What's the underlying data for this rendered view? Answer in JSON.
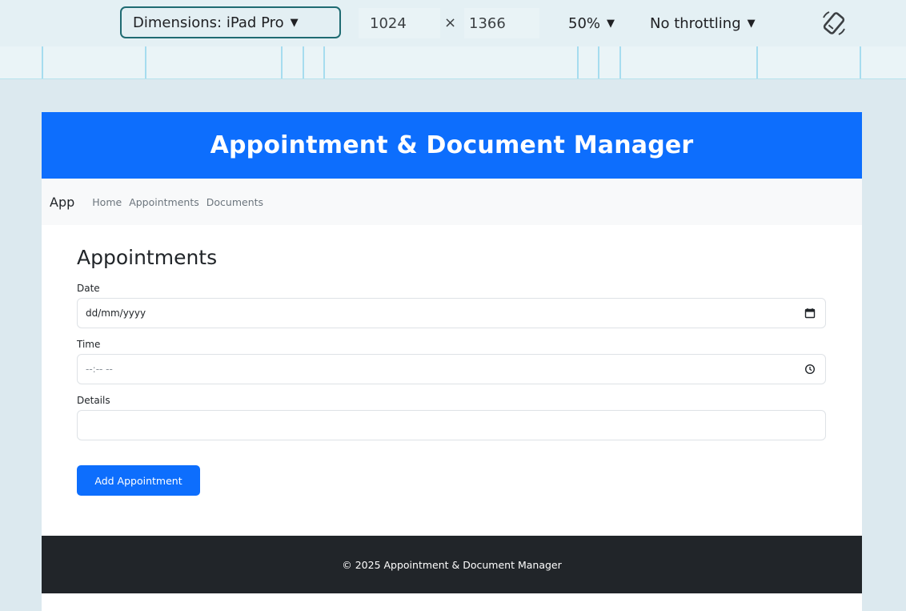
{
  "devtools": {
    "dimensions_label": "Dimensions: iPad Pro",
    "width": "1024",
    "times": "×",
    "height": "1366",
    "zoom": "50%",
    "throttling": "No throttling"
  },
  "header": {
    "title": "Appointment & Document Manager"
  },
  "nav": {
    "brand": "App",
    "links": [
      "Home",
      "Appointments",
      "Documents"
    ]
  },
  "appointments": {
    "title": "Appointments",
    "date_label": "Date",
    "date_value": "dd/mm/yyyy",
    "time_label": "Time",
    "time_value": "--:-- --",
    "details_label": "Details",
    "details_value": "",
    "add_button": "Add Appointment"
  },
  "footer": {
    "text": "© 2025 Appointment & Document Manager"
  }
}
